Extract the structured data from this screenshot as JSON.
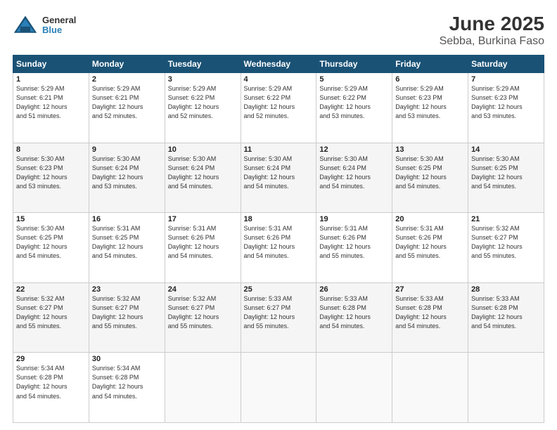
{
  "header": {
    "logo_line1": "General",
    "logo_line2": "Blue",
    "title": "June 2025",
    "subtitle": "Sebba, Burkina Faso"
  },
  "weekdays": [
    "Sunday",
    "Monday",
    "Tuesday",
    "Wednesday",
    "Thursday",
    "Friday",
    "Saturday"
  ],
  "weeks": [
    [
      {
        "day": "1",
        "lines": [
          "Sunrise: 5:29 AM",
          "Sunset: 6:21 PM",
          "Daylight: 12 hours",
          "and 51 minutes."
        ]
      },
      {
        "day": "2",
        "lines": [
          "Sunrise: 5:29 AM",
          "Sunset: 6:21 PM",
          "Daylight: 12 hours",
          "and 52 minutes."
        ]
      },
      {
        "day": "3",
        "lines": [
          "Sunrise: 5:29 AM",
          "Sunset: 6:22 PM",
          "Daylight: 12 hours",
          "and 52 minutes."
        ]
      },
      {
        "day": "4",
        "lines": [
          "Sunrise: 5:29 AM",
          "Sunset: 6:22 PM",
          "Daylight: 12 hours",
          "and 52 minutes."
        ]
      },
      {
        "day": "5",
        "lines": [
          "Sunrise: 5:29 AM",
          "Sunset: 6:22 PM",
          "Daylight: 12 hours",
          "and 53 minutes."
        ]
      },
      {
        "day": "6",
        "lines": [
          "Sunrise: 5:29 AM",
          "Sunset: 6:23 PM",
          "Daylight: 12 hours",
          "and 53 minutes."
        ]
      },
      {
        "day": "7",
        "lines": [
          "Sunrise: 5:29 AM",
          "Sunset: 6:23 PM",
          "Daylight: 12 hours",
          "and 53 minutes."
        ]
      }
    ],
    [
      {
        "day": "8",
        "lines": [
          "Sunrise: 5:30 AM",
          "Sunset: 6:23 PM",
          "Daylight: 12 hours",
          "and 53 minutes."
        ]
      },
      {
        "day": "9",
        "lines": [
          "Sunrise: 5:30 AM",
          "Sunset: 6:24 PM",
          "Daylight: 12 hours",
          "and 53 minutes."
        ]
      },
      {
        "day": "10",
        "lines": [
          "Sunrise: 5:30 AM",
          "Sunset: 6:24 PM",
          "Daylight: 12 hours",
          "and 54 minutes."
        ]
      },
      {
        "day": "11",
        "lines": [
          "Sunrise: 5:30 AM",
          "Sunset: 6:24 PM",
          "Daylight: 12 hours",
          "and 54 minutes."
        ]
      },
      {
        "day": "12",
        "lines": [
          "Sunrise: 5:30 AM",
          "Sunset: 6:24 PM",
          "Daylight: 12 hours",
          "and 54 minutes."
        ]
      },
      {
        "day": "13",
        "lines": [
          "Sunrise: 5:30 AM",
          "Sunset: 6:25 PM",
          "Daylight: 12 hours",
          "and 54 minutes."
        ]
      },
      {
        "day": "14",
        "lines": [
          "Sunrise: 5:30 AM",
          "Sunset: 6:25 PM",
          "Daylight: 12 hours",
          "and 54 minutes."
        ]
      }
    ],
    [
      {
        "day": "15",
        "lines": [
          "Sunrise: 5:30 AM",
          "Sunset: 6:25 PM",
          "Daylight: 12 hours",
          "and 54 minutes."
        ]
      },
      {
        "day": "16",
        "lines": [
          "Sunrise: 5:31 AM",
          "Sunset: 6:25 PM",
          "Daylight: 12 hours",
          "and 54 minutes."
        ]
      },
      {
        "day": "17",
        "lines": [
          "Sunrise: 5:31 AM",
          "Sunset: 6:26 PM",
          "Daylight: 12 hours",
          "and 54 minutes."
        ]
      },
      {
        "day": "18",
        "lines": [
          "Sunrise: 5:31 AM",
          "Sunset: 6:26 PM",
          "Daylight: 12 hours",
          "and 54 minutes."
        ]
      },
      {
        "day": "19",
        "lines": [
          "Sunrise: 5:31 AM",
          "Sunset: 6:26 PM",
          "Daylight: 12 hours",
          "and 55 minutes."
        ]
      },
      {
        "day": "20",
        "lines": [
          "Sunrise: 5:31 AM",
          "Sunset: 6:26 PM",
          "Daylight: 12 hours",
          "and 55 minutes."
        ]
      },
      {
        "day": "21",
        "lines": [
          "Sunrise: 5:32 AM",
          "Sunset: 6:27 PM",
          "Daylight: 12 hours",
          "and 55 minutes."
        ]
      }
    ],
    [
      {
        "day": "22",
        "lines": [
          "Sunrise: 5:32 AM",
          "Sunset: 6:27 PM",
          "Daylight: 12 hours",
          "and 55 minutes."
        ]
      },
      {
        "day": "23",
        "lines": [
          "Sunrise: 5:32 AM",
          "Sunset: 6:27 PM",
          "Daylight: 12 hours",
          "and 55 minutes."
        ]
      },
      {
        "day": "24",
        "lines": [
          "Sunrise: 5:32 AM",
          "Sunset: 6:27 PM",
          "Daylight: 12 hours",
          "and 55 minutes."
        ]
      },
      {
        "day": "25",
        "lines": [
          "Sunrise: 5:33 AM",
          "Sunset: 6:27 PM",
          "Daylight: 12 hours",
          "and 55 minutes."
        ]
      },
      {
        "day": "26",
        "lines": [
          "Sunrise: 5:33 AM",
          "Sunset: 6:28 PM",
          "Daylight: 12 hours",
          "and 54 minutes."
        ]
      },
      {
        "day": "27",
        "lines": [
          "Sunrise: 5:33 AM",
          "Sunset: 6:28 PM",
          "Daylight: 12 hours",
          "and 54 minutes."
        ]
      },
      {
        "day": "28",
        "lines": [
          "Sunrise: 5:33 AM",
          "Sunset: 6:28 PM",
          "Daylight: 12 hours",
          "and 54 minutes."
        ]
      }
    ],
    [
      {
        "day": "29",
        "lines": [
          "Sunrise: 5:34 AM",
          "Sunset: 6:28 PM",
          "Daylight: 12 hours",
          "and 54 minutes."
        ]
      },
      {
        "day": "30",
        "lines": [
          "Sunrise: 5:34 AM",
          "Sunset: 6:28 PM",
          "Daylight: 12 hours",
          "and 54 minutes."
        ]
      },
      {
        "day": "",
        "lines": []
      },
      {
        "day": "",
        "lines": []
      },
      {
        "day": "",
        "lines": []
      },
      {
        "day": "",
        "lines": []
      },
      {
        "day": "",
        "lines": []
      }
    ]
  ]
}
